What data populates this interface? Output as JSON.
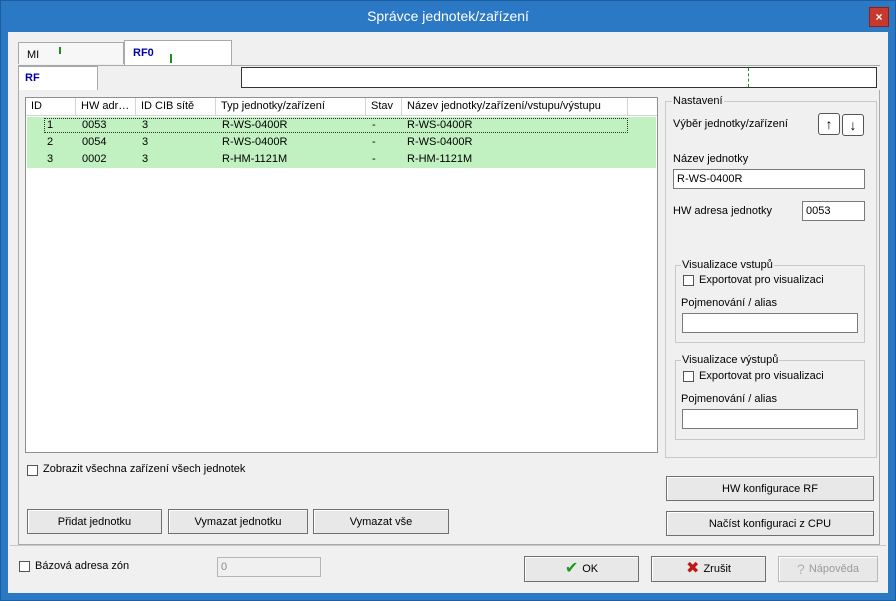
{
  "window": {
    "title": "Správce jednotek/zařízení",
    "close_glyph": "×"
  },
  "tabs": {
    "top": [
      {
        "label": "MI"
      },
      {
        "label": "RF0"
      }
    ],
    "sub": {
      "label": "RF"
    }
  },
  "list": {
    "columns": [
      "ID",
      "HW adr…",
      "ID CIB sítě",
      "Typ jednotky/zařízení",
      "Stav",
      "Název jednotky/zařízení/vstupu/výstupu"
    ],
    "rows": [
      {
        "id": "1",
        "hw": "0053",
        "cib": "3",
        "type": "R-WS-0400R",
        "state": "-",
        "name": "R-WS-0400R"
      },
      {
        "id": "2",
        "hw": "0054",
        "cib": "3",
        "type": "R-WS-0400R",
        "state": "-",
        "name": "R-WS-0400R"
      },
      {
        "id": "3",
        "hw": "0002",
        "cib": "3",
        "type": "R-HM-1121M",
        "state": "-",
        "name": "R-HM-1121M"
      }
    ],
    "row_color": "#c1f0c1"
  },
  "show_all": {
    "label": "Zobrazit všechna zařízení všech jednotek"
  },
  "buttons": {
    "add_unit": "Přidat jednotku",
    "delete_unit": "Vymazat jednotku",
    "delete_all": "Vymazat vše",
    "hw_config": "HW konfigurace RF",
    "load_config": "Načíst konfiguraci z CPU",
    "ok": "OK",
    "cancel": "Zrušit",
    "help": "Nápověda"
  },
  "settings": {
    "title": "Nastavení",
    "selection_label": "Výběr jednotky/zařízení",
    "up_glyph": "↑",
    "down_glyph": "↓",
    "unit_name_label": "Název jednotky",
    "unit_name_value": "R-WS-0400R",
    "hw_address_label": "HW adresa jednotky",
    "hw_address_value": "0053",
    "inputs_vis": {
      "title": "Visualizace vstupů",
      "export_label": "Exportovat pro visualizaci",
      "alias_label": "Pojmenování / alias",
      "alias_value": ""
    },
    "outputs_vis": {
      "title": "Visualizace výstupů",
      "export_label": "Exportovat pro visualizaci",
      "alias_label": "Pojmenování / alias",
      "alias_value": ""
    }
  },
  "base_zone": {
    "label": "Bázová adresa zón",
    "value": "0"
  },
  "icons": {
    "ok": "check-icon",
    "cancel": "x-icon",
    "help": "help-icon"
  },
  "colors": {
    "titlebar": "#2b78c5",
    "close": "#c7392d",
    "accent_tab": "#0000aa",
    "indicator": "#1e8f1e"
  }
}
